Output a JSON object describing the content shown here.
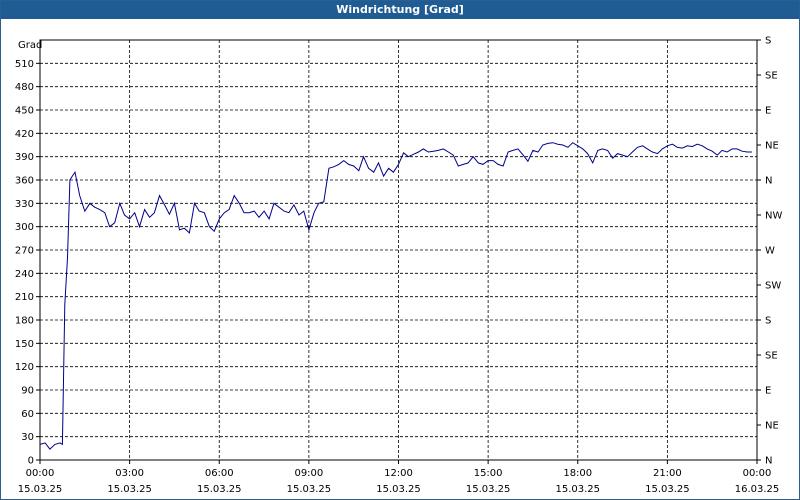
{
  "window": {
    "title": "Windrichtung [Grad]"
  },
  "chart_data": {
    "type": "line",
    "title": "Windrichtung [Grad]",
    "ylabel": "Grad",
    "ylim": [
      0,
      540
    ],
    "y_ticks": [
      0,
      30,
      60,
      90,
      120,
      150,
      180,
      210,
      240,
      270,
      300,
      330,
      360,
      390,
      420,
      450,
      480,
      510
    ],
    "y2_labels": [
      "N",
      "NE",
      "E",
      "SE",
      "S",
      "SW",
      "W",
      "NW",
      "N",
      "NE",
      "E",
      "SE",
      "S"
    ],
    "x_ticks": [
      {
        "time": "00:00",
        "date": "15.03.25"
      },
      {
        "time": "03:00",
        "date": "15.03.25"
      },
      {
        "time": "06:00",
        "date": "15.03.25"
      },
      {
        "time": "09:00",
        "date": "15.03.25"
      },
      {
        "time": "12:00",
        "date": "15.03.25"
      },
      {
        "time": "15:00",
        "date": "15.03.25"
      },
      {
        "time": "18:00",
        "date": "15.03.25"
      },
      {
        "time": "21:00",
        "date": "15.03.25"
      },
      {
        "time": "00:00",
        "date": "16.03.25"
      }
    ],
    "grid": true,
    "line_color": "#00008b",
    "series": [
      {
        "x_hours": [
          0,
          0.17,
          0.33,
          0.5,
          0.67,
          0.75,
          0.83,
          0.92,
          1.0,
          1.08,
          1.17,
          1.33,
          1.5,
          1.67,
          1.83,
          2.0,
          2.17,
          2.33,
          2.5,
          2.67,
          2.83,
          3.0,
          3.17,
          3.33,
          3.5,
          3.67,
          3.83,
          4.0,
          4.17,
          4.33,
          4.5,
          4.67,
          4.83,
          5.0,
          5.17,
          5.33,
          5.5,
          5.67,
          5.83,
          6.0,
          6.17,
          6.33,
          6.5,
          6.67,
          6.83,
          7.0,
          7.17,
          7.33,
          7.5,
          7.67,
          7.83,
          8.0,
          8.17,
          8.33,
          8.5,
          8.67,
          8.83,
          9.0,
          9.17,
          9.33,
          9.5,
          9.67,
          9.83,
          10.0,
          10.17,
          10.33,
          10.5,
          10.67,
          10.83,
          11.0,
          11.17,
          11.33,
          11.5,
          11.67,
          11.83,
          12.0,
          12.17,
          12.33,
          12.5,
          12.67,
          12.83,
          13.0,
          13.17,
          13.33,
          13.5,
          13.67,
          13.83,
          14.0,
          14.17,
          14.33,
          14.5,
          14.67,
          14.83,
          15.0,
          15.17,
          15.33,
          15.5,
          15.67,
          15.83,
          16.0,
          16.17,
          16.33,
          16.5,
          16.67,
          16.83,
          17.0,
          17.17,
          17.33,
          17.5,
          17.67,
          17.83,
          18.0,
          18.17,
          18.33,
          18.5,
          18.67,
          18.83,
          19.0,
          19.17,
          19.33,
          19.5,
          19.67,
          19.83,
          20.0,
          20.17,
          20.33,
          20.5,
          20.67,
          20.83,
          21.0,
          21.17,
          21.33,
          21.5,
          21.67,
          21.83,
          22.0,
          22.17,
          22.33,
          22.5,
          22.67,
          22.83,
          23.0,
          23.17,
          23.33,
          23.5,
          23.67,
          23.83,
          24.0
        ],
        "values": [
          20,
          22,
          14,
          20,
          22,
          20,
          200,
          260,
          360,
          365,
          370,
          340,
          320,
          330,
          325,
          322,
          318,
          300,
          305,
          330,
          315,
          310,
          318,
          300,
          322,
          312,
          318,
          340,
          328,
          316,
          330,
          296,
          298,
          292,
          330,
          320,
          318,
          300,
          294,
          310,
          318,
          322,
          340,
          330,
          318,
          318,
          320,
          312,
          320,
          310,
          330,
          325,
          320,
          318,
          328,
          315,
          320,
          296,
          318,
          330,
          332,
          375,
          377,
          380,
          385,
          380,
          378,
          372,
          390,
          375,
          370,
          382,
          365,
          375,
          370,
          380,
          395,
          390,
          393,
          396,
          400,
          396,
          397,
          398,
          400,
          396,
          392,
          378,
          380,
          382,
          390,
          382,
          380,
          385,
          385,
          380,
          378,
          396,
          398,
          400,
          392,
          384,
          398,
          396,
          405,
          407,
          408,
          406,
          405,
          402,
          408,
          404,
          400,
          394,
          382,
          398,
          400,
          398,
          388,
          394,
          392,
          390,
          396,
          402,
          404,
          400,
          396,
          394,
          400,
          404,
          406,
          402,
          401,
          404,
          403,
          406,
          404,
          400,
          397,
          392,
          398,
          396,
          400,
          400,
          397,
          396,
          396
        ]
      }
    ]
  }
}
